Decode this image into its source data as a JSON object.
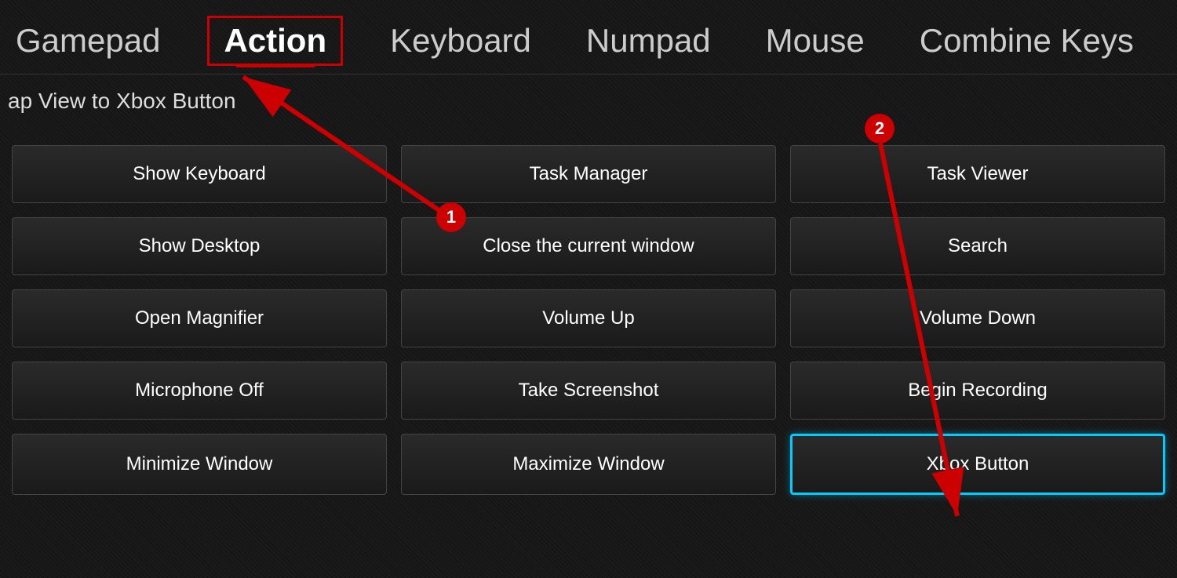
{
  "nav": {
    "tabs": [
      {
        "id": "gamepad",
        "label": "Gamepad",
        "active": false
      },
      {
        "id": "action",
        "label": "Action",
        "active": true
      },
      {
        "id": "keyboard",
        "label": "Keyboard",
        "active": false
      },
      {
        "id": "numpad",
        "label": "Numpad",
        "active": false
      },
      {
        "id": "mouse",
        "label": "Mouse",
        "active": false
      },
      {
        "id": "combine-keys",
        "label": "Combine Keys",
        "active": false
      }
    ]
  },
  "subtitle": "ap View to Xbox Button",
  "buttons": {
    "col1": [
      {
        "id": "show-keyboard",
        "label": "Show Keyboard"
      },
      {
        "id": "show-desktop",
        "label": "Show Desktop"
      },
      {
        "id": "open-magnifier",
        "label": "Open Magnifier"
      },
      {
        "id": "microphone-off",
        "label": "Microphone Off"
      },
      {
        "id": "minimize-window",
        "label": "Minimize Window"
      }
    ],
    "col2": [
      {
        "id": "task-manager",
        "label": "Task Manager"
      },
      {
        "id": "close-window",
        "label": "Close the current window"
      },
      {
        "id": "volume-up",
        "label": "Volume Up"
      },
      {
        "id": "take-screenshot",
        "label": "Take Screenshot"
      },
      {
        "id": "maximize-window",
        "label": "Maximize Window"
      }
    ],
    "col3": [
      {
        "id": "task-viewer",
        "label": "Task Viewer"
      },
      {
        "id": "search",
        "label": "Search"
      },
      {
        "id": "volume-down",
        "label": "Volume Down"
      },
      {
        "id": "begin-recording",
        "label": "Begin Recording"
      },
      {
        "id": "xbox-button",
        "label": "Xbox Button",
        "highlighted": true
      }
    ]
  },
  "annotations": {
    "badge1_number": "1",
    "badge2_number": "2"
  }
}
